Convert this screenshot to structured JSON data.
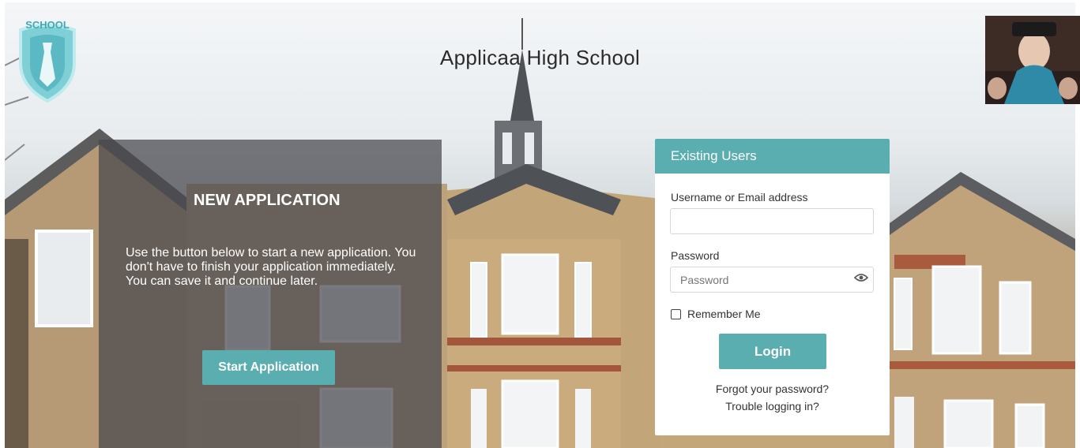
{
  "header": {
    "school_name": "Applicaa High School",
    "logo_text": "SCHOOL"
  },
  "new_application": {
    "heading": "NEW APPLICATION",
    "description": "Use the button below to start a new application. You don't have to finish your application immediately. You can save it and continue later.",
    "start_button_label": "Start Application"
  },
  "login": {
    "header": "Existing Users",
    "username_label": "Username or Email address",
    "username_value": "",
    "username_placeholder": "",
    "password_label": "Password",
    "password_value": "",
    "password_placeholder": "Password",
    "remember_label": "Remember Me",
    "remember_checked": false,
    "login_button_label": "Login",
    "forgot_link": "Forgot your password?",
    "trouble_link": "Trouble logging in?"
  },
  "colors": {
    "accent": "#5aaeb0",
    "panel_overlay": "#46464e"
  }
}
